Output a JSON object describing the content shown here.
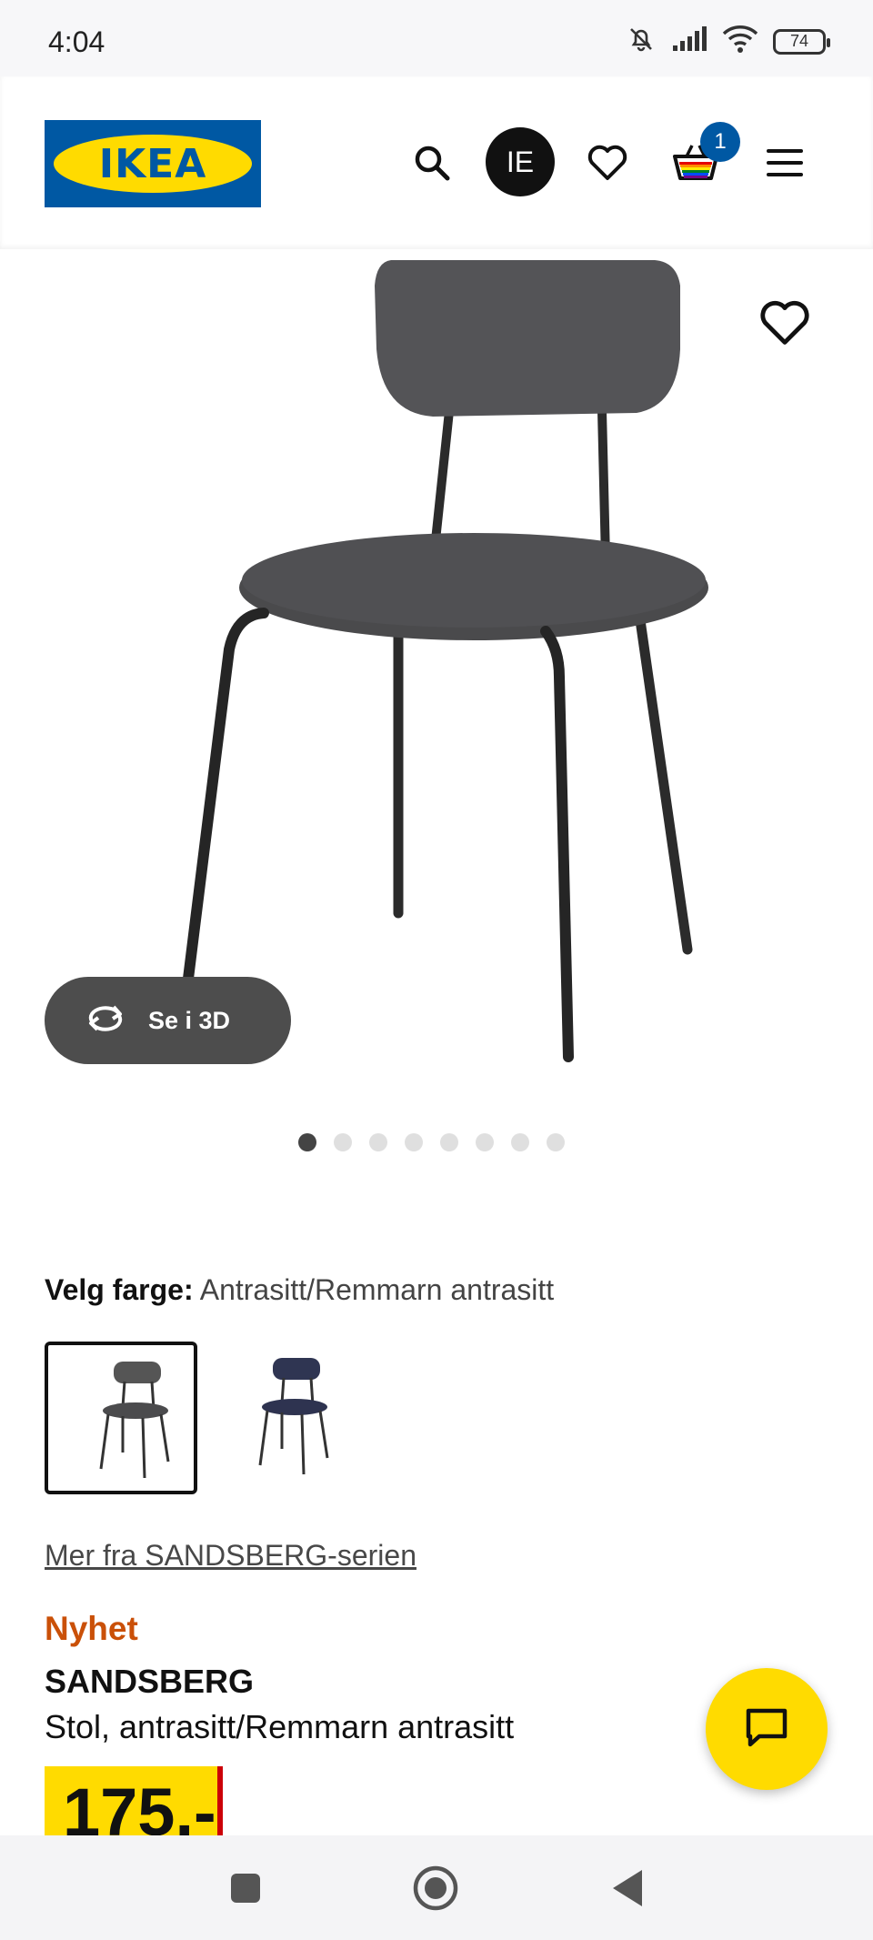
{
  "status_bar": {
    "time": "4:04",
    "battery": "74",
    "icons": [
      "mute-icon",
      "signal-icon",
      "wifi-icon",
      "battery-icon"
    ]
  },
  "header": {
    "logo_text": "IKEA",
    "country_code": "IE",
    "cart_count": "1",
    "icons": [
      "search-icon",
      "heart-icon",
      "cart-icon",
      "menu-icon"
    ]
  },
  "gallery": {
    "view_3d_label": "Se i 3D",
    "image_count": 8,
    "active_index": 0
  },
  "color_select": {
    "label": "Velg farge:",
    "value": "Antrasitt/Remmarn antrasitt",
    "options": [
      "antrasitt",
      "blue"
    ]
  },
  "product": {
    "series_link": "Mer fra SANDSBERG-serien",
    "badge": "Nyhet",
    "name": "SANDSBERG",
    "description": "Stol, antrasitt/Remmarn antrasitt",
    "price": "175.-"
  },
  "colors": {
    "brand_blue": "#0058a3",
    "brand_yellow": "#ffdb00",
    "new_orange": "#ca5008",
    "price_red": "#cc0008"
  }
}
